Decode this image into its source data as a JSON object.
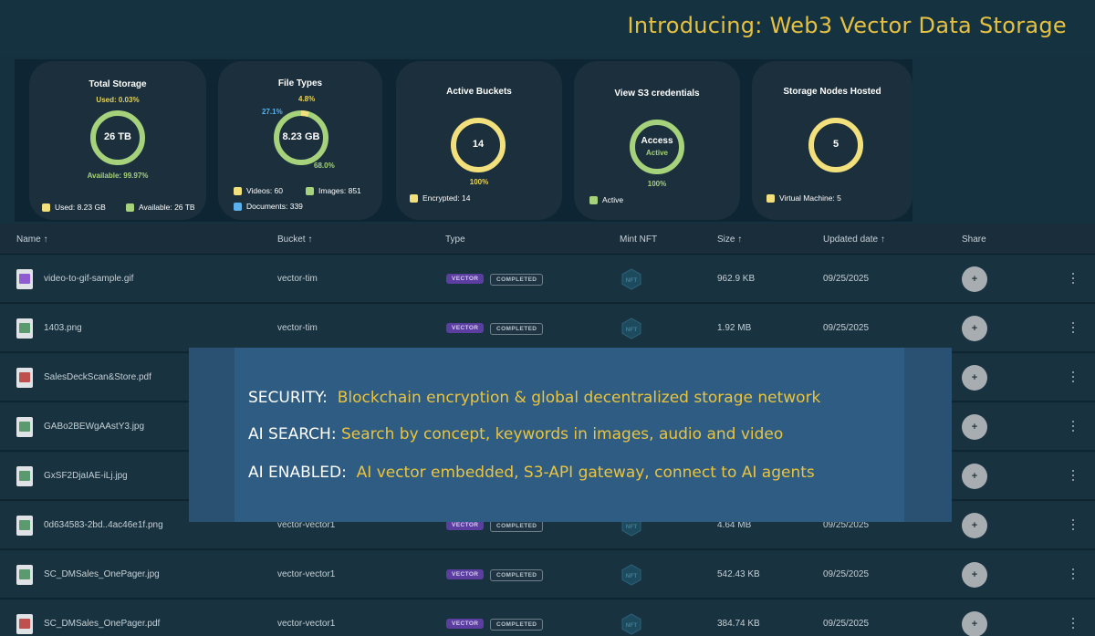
{
  "headline": "Introducing: Web3 Vector Data Storage",
  "colors": {
    "yellow": "#f2e07c",
    "green": "#a6d27b",
    "blue": "#5ab1ec",
    "accent": "#e6c041"
  },
  "cards": {
    "total_storage": {
      "title": "Total Storage",
      "used_note": "Used: 0.03%",
      "center": "26 TB",
      "available_note": "Available: 99.97%",
      "used_fraction": 0.0003,
      "legend_used": "Used: 8.23 GB",
      "legend_available": "Available: 26 TB"
    },
    "file_types": {
      "title": "File Types",
      "center": "8.23 GB",
      "pct_top": "4.8%",
      "pct_left": "27.1%",
      "pct_bottom": "68.0%",
      "segments": [
        {
          "name": "Videos",
          "fraction": 0.048,
          "color": "#f2e07c"
        },
        {
          "name": "Images",
          "fraction": 0.68,
          "color": "#a6d27b"
        },
        {
          "name": "Documents",
          "fraction": 0.271,
          "color": "#5ab1ec"
        }
      ],
      "legend_videos": "Videos: 60",
      "legend_images": "Images: 851",
      "legend_documents": "Documents: 339"
    },
    "active_buckets": {
      "title": "Active Buckets",
      "center": "14",
      "pct": "100%",
      "legend": "Encrypted: 14"
    },
    "s3": {
      "title": "View S3 credentials",
      "center": "Access",
      "status": "Active",
      "pct": "100%",
      "legend": "Active"
    },
    "nodes": {
      "title": "Storage Nodes Hosted",
      "center": "5",
      "legend": "Virtual Machine: 5"
    }
  },
  "table": {
    "headers": {
      "name": "Name ↑",
      "bucket": "Bucket ↑",
      "type": "Type",
      "mint": "Mint NFT",
      "size": "Size ↑",
      "updated": "Updated date ↑",
      "share": "Share"
    },
    "badge_vector": "VECTOR",
    "badge_completed": "COMPLETED",
    "nft_label": "NFT",
    "share_symbol": "+",
    "rows": [
      {
        "name": "video-to-gif-sample.gif",
        "bucket": "vector-tim",
        "size": "962.9 KB",
        "date": "09/25/2025",
        "icon": "gif-file-icon"
      },
      {
        "name": "1403.png",
        "bucket": "vector-tim",
        "size": "1.92 MB",
        "date": "09/25/2025",
        "icon": "image-file-icon"
      },
      {
        "name": "SalesDeckScan&Store.pdf",
        "bucket": "",
        "size": "",
        "date": "",
        "icon": "pdf-file-icon"
      },
      {
        "name": "GABo2BEWgAAstY3.jpg",
        "bucket": "",
        "size": "",
        "date": "",
        "icon": "image-file-icon"
      },
      {
        "name": "GxSF2DjaIAE-iLj.jpg",
        "bucket": "",
        "size": "",
        "date": "",
        "icon": "image-file-icon"
      },
      {
        "name": "0d634583-2bd..4ac46e1f.png",
        "bucket": "vector-vector1",
        "size": "4.64 MB",
        "date": "09/25/2025",
        "icon": "image-file-icon"
      },
      {
        "name": "SC_DMSales_OnePager.jpg",
        "bucket": "vector-vector1",
        "size": "542.43 KB",
        "date": "09/25/2025",
        "icon": "image-file-icon"
      },
      {
        "name": "SC_DMSales_OnePager.pdf",
        "bucket": "vector-vector1",
        "size": "384.74 KB",
        "date": "09/25/2025",
        "icon": "pdf-file-icon"
      }
    ]
  },
  "overlay": {
    "security_key": "SECURITY:",
    "security_val": "Blockchain encryption & global decentralized storage network",
    "search_key": "AI SEARCH:",
    "search_val": "Search by concept, keywords in images, audio and video",
    "enabled_key": "AI ENABLED:",
    "enabled_val": "AI vector embedded, S3-API gateway, connect to AI agents"
  }
}
